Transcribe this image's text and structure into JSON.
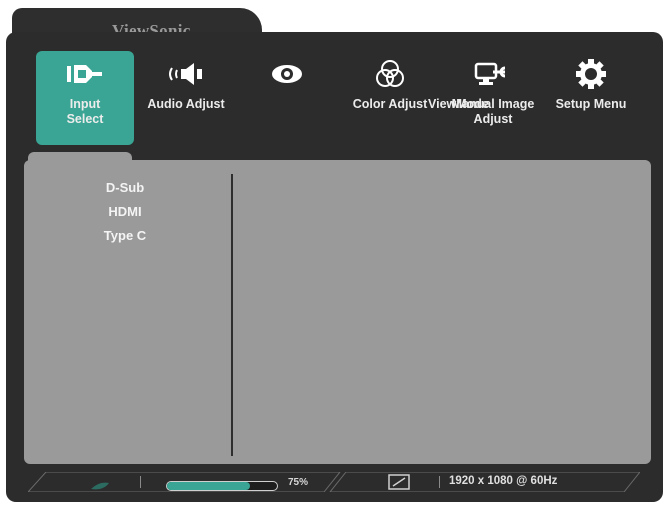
{
  "brand": "ViewSonic",
  "menu": [
    {
      "label": "Input\nSelect",
      "icon": "input-source-icon",
      "active": true
    },
    {
      "label": "Audio Adjust",
      "icon": "speaker-icon",
      "active": false
    },
    {
      "label": "",
      "icon": "eye-icon",
      "active": false
    },
    {
      "label": "Color Adjust",
      "icon": "color-circles-icon",
      "active": false
    },
    {
      "label": "ViewMode",
      "icon": "",
      "active": false
    },
    {
      "label": "Manual Image\nAdjust",
      "icon": "monitor-wrench-icon",
      "active": false
    },
    {
      "label": "Setup Menu",
      "icon": "gear-icon",
      "active": false
    }
  ],
  "submenu": [
    "D-Sub",
    "HDMI",
    "Type C"
  ],
  "status": {
    "brightness_percent": "75%",
    "brightness_level": 0.75,
    "resolution": "1920 x 1080 @ 60Hz"
  },
  "colors": {
    "accent": "#3aa594",
    "frame": "#2c2c2c",
    "panel": "#9a9a9a"
  }
}
